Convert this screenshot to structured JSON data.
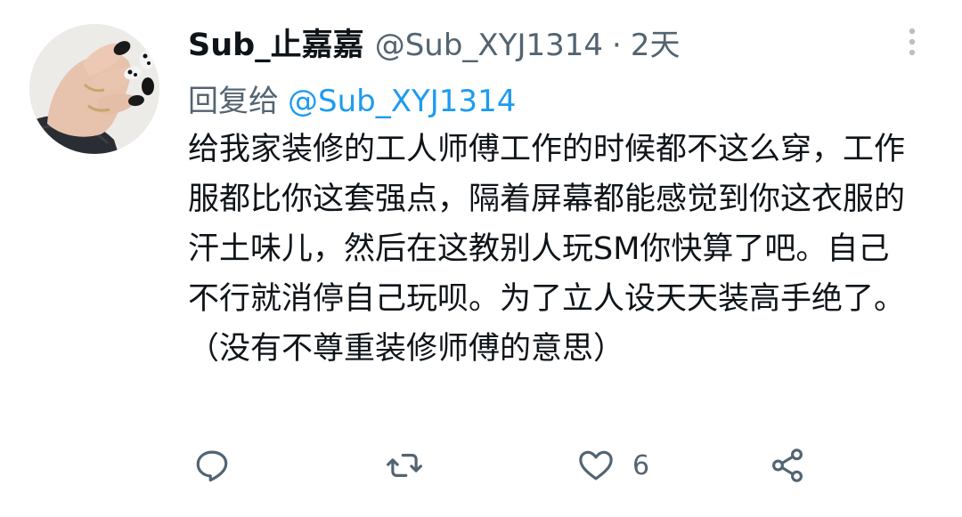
{
  "tweet": {
    "display_name": "Sub_止嘉嘉",
    "handle": "@Sub_XYJ1314",
    "separator": "·",
    "time": "2天",
    "reply_prefix": "回复给",
    "reply_to": "@Sub_XYJ1314",
    "body": "给我家装修的工人师傅工作的时候都不这么穿，工作服都比你这套强点，隔着屏幕都能感觉到你这衣服的汗土味儿，然后在这教别人玩SM你快算了吧。自己不行就消停自己玩呗。为了立人设天天装高手绝了。（没有不尊重装修师傅的意思）"
  },
  "actions": {
    "reply_icon": "reply-icon",
    "retweet_icon": "retweet-icon",
    "like_icon": "heart-icon",
    "like_count": "6",
    "share_icon": "share-icon"
  },
  "colors": {
    "text": "#0f1419",
    "secondary": "#536471",
    "link": "#1d9bf0",
    "background": "#ffffff"
  }
}
